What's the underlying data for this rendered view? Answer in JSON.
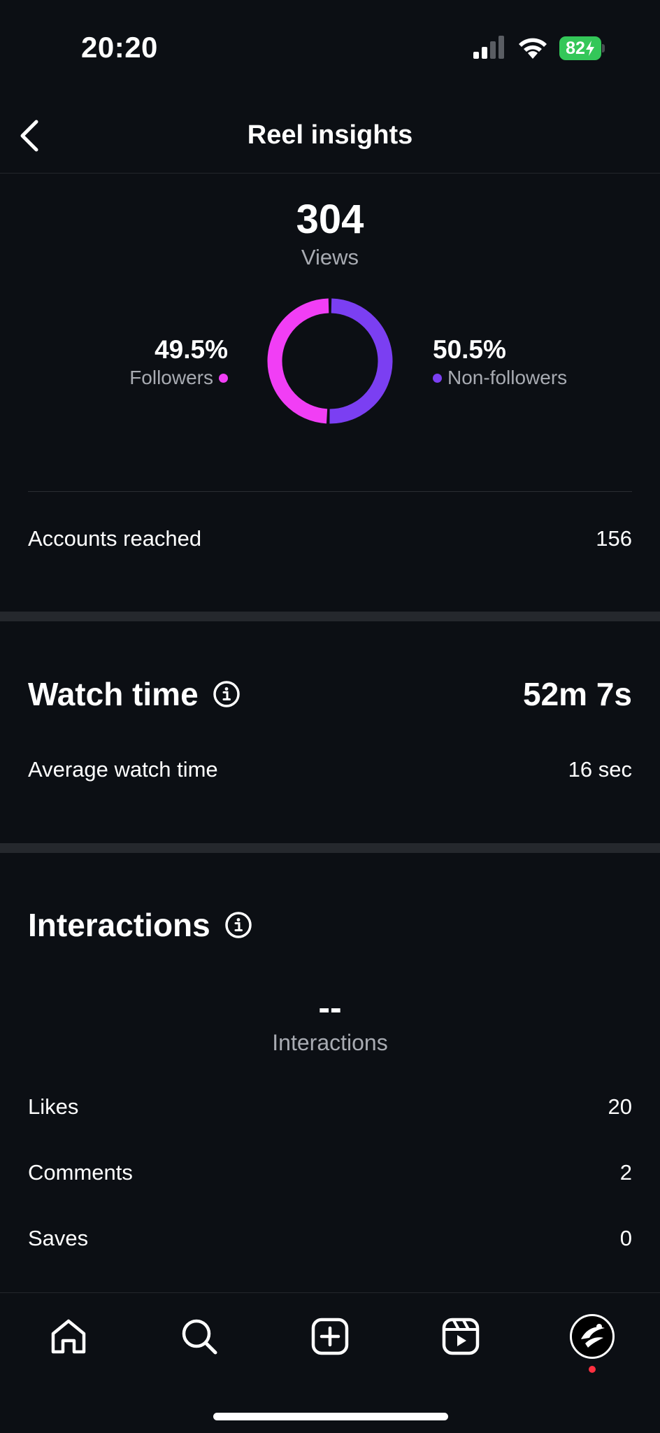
{
  "status_bar": {
    "time": "20:20",
    "battery": "82"
  },
  "nav": {
    "title": "Reel insights"
  },
  "views": {
    "count": "304",
    "label": "Views",
    "followers_pct": "49.5%",
    "followers_label": "Followers",
    "nonfollowers_pct": "50.5%",
    "nonfollowers_label": "Non-followers",
    "followers_fraction": 0.495,
    "followers_color": "#f13ef5",
    "nonfollowers_color": "#7b3ff2"
  },
  "accounts_reached": {
    "label": "Accounts reached",
    "value": "156"
  },
  "watch_time": {
    "title": "Watch time",
    "total": "52m 7s",
    "avg_label": "Average watch time",
    "avg_value": "16 sec"
  },
  "interactions": {
    "title": "Interactions",
    "total": "--",
    "total_label": "Interactions",
    "rows": [
      {
        "label": "Likes",
        "value": "20"
      },
      {
        "label": "Comments",
        "value": "2"
      },
      {
        "label": "Saves",
        "value": "0"
      }
    ]
  },
  "tab_bar": {
    "icons": [
      "home-icon",
      "search-icon",
      "create-icon",
      "reels-icon",
      "profile-avatar"
    ]
  }
}
